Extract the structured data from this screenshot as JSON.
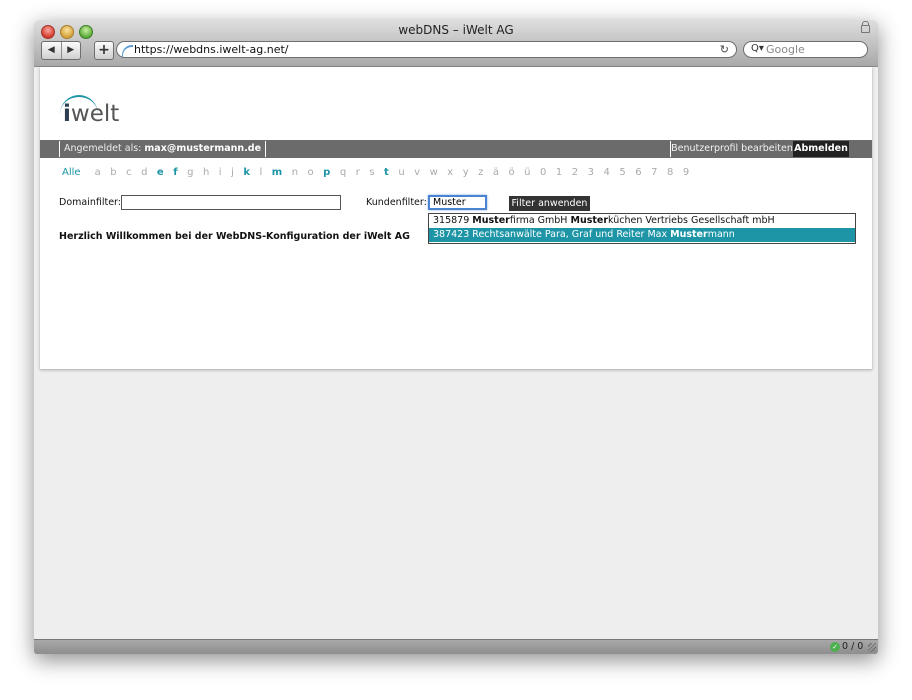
{
  "window": {
    "title": "webDNS – iWelt AG"
  },
  "toolbar": {
    "back": "◀",
    "forward": "▶",
    "new_tab": "+",
    "url": "https://webdns.iwelt-ag.net/",
    "search_placeholder": "Google"
  },
  "logo": {
    "prefix": "i",
    "rest": "welt"
  },
  "topbar": {
    "login_label": "Angemeldet als:",
    "login_user": "max@mustermann.de",
    "profile": "Benutzerprofil bearbeiten",
    "logout": "Abmelden"
  },
  "letters": {
    "all": "Alle",
    "items": [
      {
        "t": "a",
        "active": false
      },
      {
        "t": "b",
        "active": false
      },
      {
        "t": "c",
        "active": false
      },
      {
        "t": "d",
        "active": false
      },
      {
        "t": "e",
        "active": true
      },
      {
        "t": "f",
        "active": true
      },
      {
        "t": "g",
        "active": false
      },
      {
        "t": "h",
        "active": false
      },
      {
        "t": "i",
        "active": false
      },
      {
        "t": "j",
        "active": false
      },
      {
        "t": "k",
        "active": true
      },
      {
        "t": "l",
        "active": false
      },
      {
        "t": "m",
        "active": true
      },
      {
        "t": "n",
        "active": false
      },
      {
        "t": "o",
        "active": false
      },
      {
        "t": "p",
        "active": true
      },
      {
        "t": "q",
        "active": false
      },
      {
        "t": "r",
        "active": false
      },
      {
        "t": "s",
        "active": false
      },
      {
        "t": "t",
        "active": true
      },
      {
        "t": "u",
        "active": false
      },
      {
        "t": "v",
        "active": false
      },
      {
        "t": "w",
        "active": false
      },
      {
        "t": "x",
        "active": false
      },
      {
        "t": "y",
        "active": false
      },
      {
        "t": "z",
        "active": false
      },
      {
        "t": "ä",
        "active": false
      },
      {
        "t": "ö",
        "active": false
      },
      {
        "t": "ü",
        "active": false
      },
      {
        "t": "0",
        "active": false
      },
      {
        "t": "1",
        "active": false
      },
      {
        "t": "2",
        "active": false
      },
      {
        "t": "3",
        "active": false
      },
      {
        "t": "4",
        "active": false
      },
      {
        "t": "5",
        "active": false
      },
      {
        "t": "6",
        "active": false
      },
      {
        "t": "7",
        "active": false
      },
      {
        "t": "8",
        "active": false
      },
      {
        "t": "9",
        "active": false
      }
    ]
  },
  "filters": {
    "domain_label": "Domainfilter:",
    "domain_value": "",
    "customer_label": "Kundenfilter:",
    "customer_value": "Muster",
    "apply": "Filter anwenden"
  },
  "suggestions": [
    {
      "parts": [
        {
          "t": "315879 ",
          "b": false
        },
        {
          "t": "Muster",
          "b": true
        },
        {
          "t": "firma GmbH ",
          "b": false
        },
        {
          "t": "Muster",
          "b": true
        },
        {
          "t": "küchen Vertriebs Gesellschaft mbH",
          "b": false
        }
      ],
      "selected": false
    },
    {
      "parts": [
        {
          "t": "387423 Rechtsanwälte Para, Graf und Reiter Max ",
          "b": false
        },
        {
          "t": "Muster",
          "b": true
        },
        {
          "t": "mann",
          "b": false
        }
      ],
      "selected": true
    }
  ],
  "welcome": "Herzlich Willkommen bei der WebDNS-Konfiguration der iWelt AG",
  "status": {
    "count": "0 / 0"
  },
  "colors": {
    "accent": "#1d95a6",
    "bar": "#6b6b6b"
  }
}
